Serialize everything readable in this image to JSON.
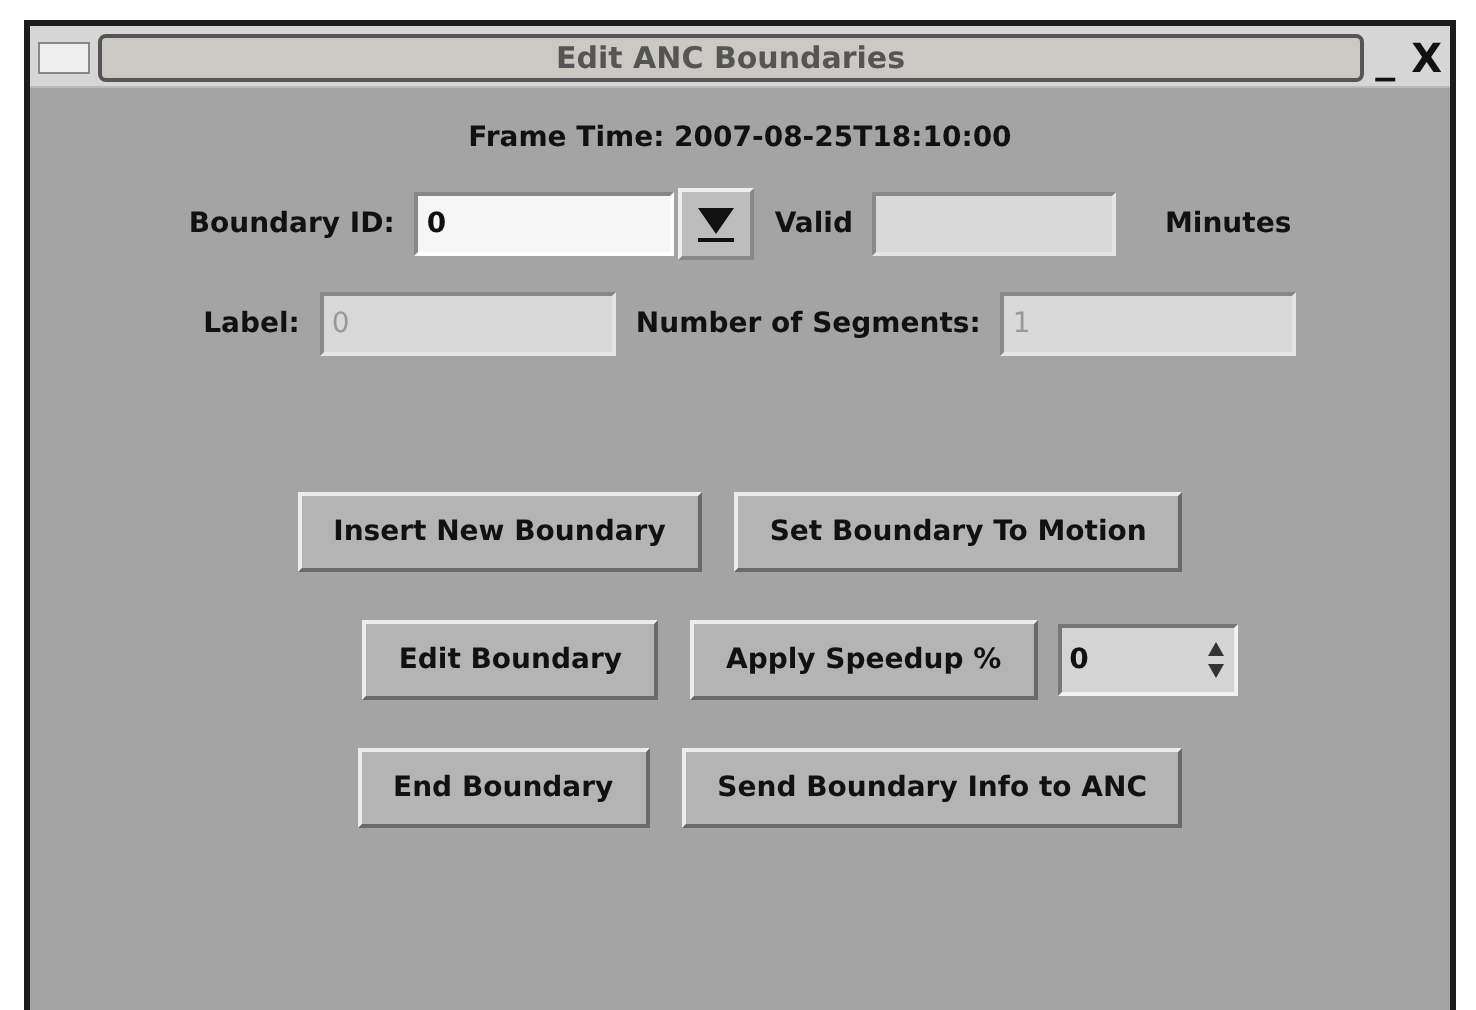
{
  "window": {
    "title": "Edit ANC Boundaries",
    "minimize": "_",
    "close": "X"
  },
  "frame_time": "Frame Time: 2007-08-25T18:10:00",
  "boundary_row": {
    "label": "Boundary ID:",
    "value": "0",
    "valid_label": "Valid",
    "valid_field": {
      "disabled": true
    },
    "unit": "Minutes"
  },
  "label_row": {
    "label": "Label:",
    "label_value": "0",
    "label_disabled": true,
    "segments_label": "Number of Segments:",
    "segments_value": "1",
    "segments_disabled": true
  },
  "button_rows": [
    {
      "items": [
        {
          "kind": "button",
          "label": "Insert New Boundary"
        },
        {
          "kind": "button",
          "label": "Set Boundary To Motion"
        }
      ]
    },
    {
      "items": [
        {
          "kind": "button",
          "label": "Edit Boundary"
        },
        {
          "kind": "button",
          "label": "Apply Speedup %"
        },
        {
          "kind": "spin",
          "value": "0"
        }
      ]
    },
    {
      "items": [
        {
          "kind": "button",
          "label": "End Boundary"
        },
        {
          "kind": "button",
          "label": "Send Boundary Info to ANC"
        }
      ]
    }
  ]
}
